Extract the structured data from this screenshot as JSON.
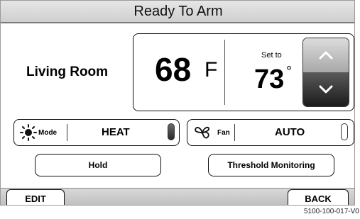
{
  "title": "Ready To Arm",
  "room": {
    "name": "Living Room"
  },
  "temperature": {
    "current_value": "68",
    "current_unit": "F",
    "set_label": "Set to",
    "set_value": "73",
    "set_symbol": "°",
    "up_icon": "chevron-up-icon",
    "down_icon": "chevron-down-icon"
  },
  "mode": {
    "label": "Mode",
    "value": "HEAT",
    "icon": "sun-icon"
  },
  "fan": {
    "label": "Fan",
    "value": "AUTO",
    "icon": "fan-icon"
  },
  "buttons": {
    "hold": "Hold",
    "threshold": "Threshold Monitoring",
    "edit": "EDIT",
    "back": "BACK"
  },
  "footer": {
    "code": "5100-100-017-V0"
  },
  "colors": {
    "title_bg": "#d8d8d8",
    "bar_bg": "#c8c8c8",
    "arrow_up_bg": "#bdbdbd",
    "arrow_down_bg": "#2f2f2f"
  }
}
